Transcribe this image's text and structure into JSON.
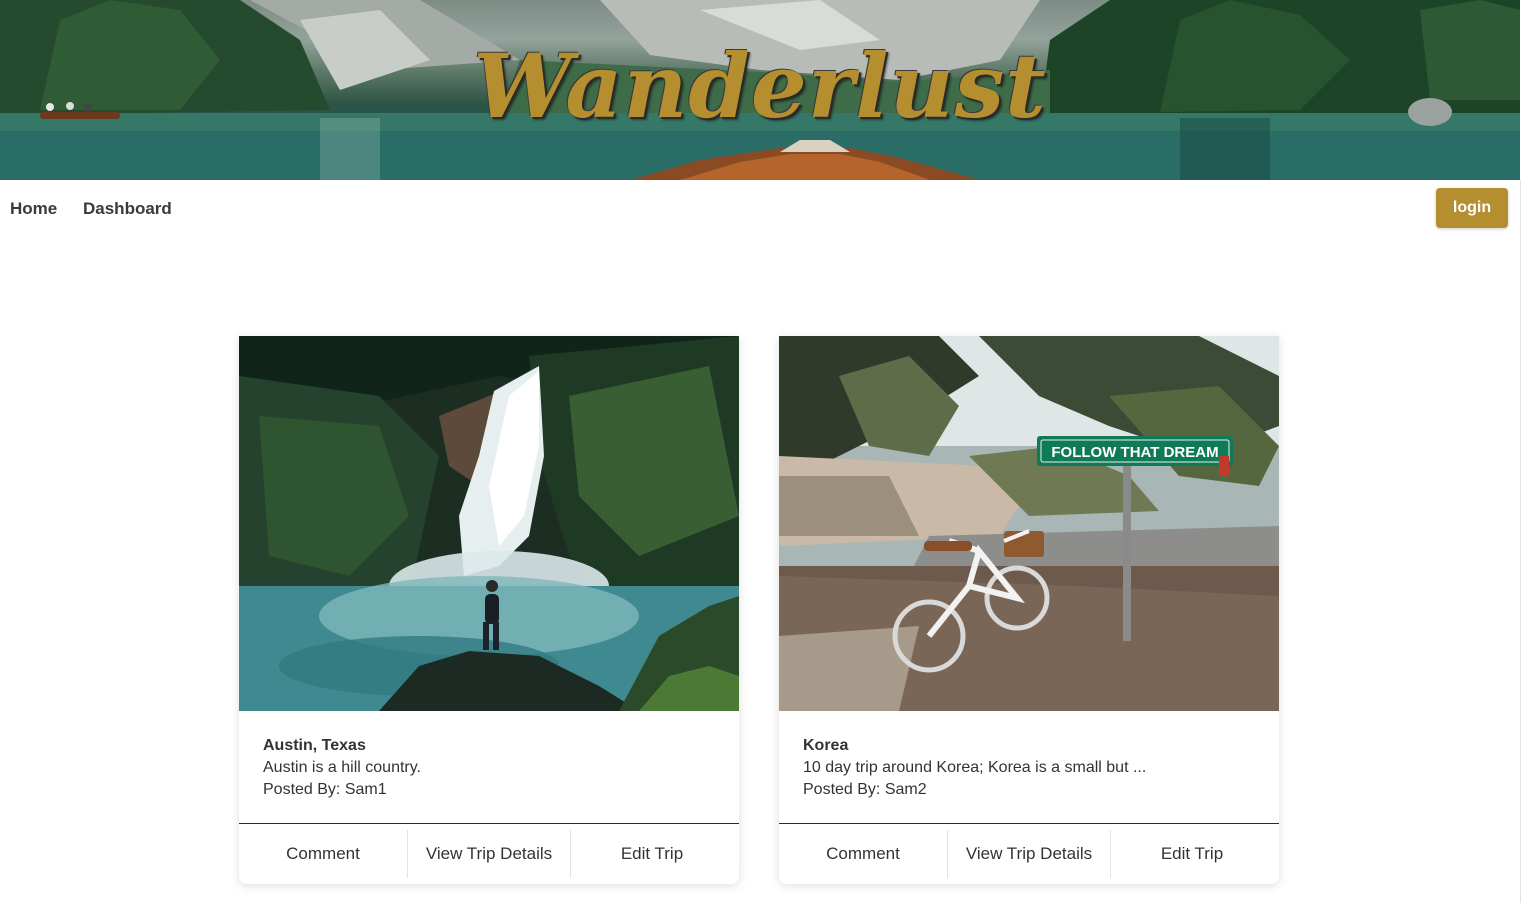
{
  "header": {
    "brand": "Wanderlust",
    "banner_image": "mountain-lake-boat-photo"
  },
  "nav": {
    "links": [
      {
        "label": "Home"
      },
      {
        "label": "Dashboard"
      }
    ],
    "login_label": "login"
  },
  "trips": [
    {
      "image": "waterfall-hiker-photo",
      "title": "Austin, Texas",
      "description": "Austin is a hill country.",
      "posted_by": "Posted By: Sam1",
      "actions": [
        "Comment",
        "View Trip Details",
        "Edit Trip"
      ]
    },
    {
      "image": "bicycle-street-sign-photo",
      "sign_text": "FOLLOW THAT DREAM",
      "title": "Korea",
      "description": "10 day trip around Korea; Korea is a small but ...",
      "posted_by": "Posted By: Sam2",
      "actions": [
        "Comment",
        "View Trip Details",
        "Edit Trip"
      ]
    }
  ],
  "colors": {
    "accent": "#b58f2f",
    "text": "#333333"
  }
}
